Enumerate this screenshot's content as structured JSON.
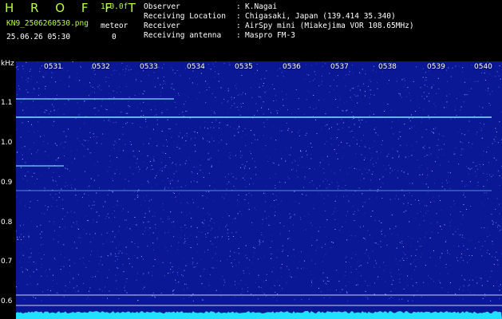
{
  "header": {
    "title": "H R O F F T",
    "version": "1.0.0f",
    "filename": "KN9_2506260530.png",
    "meteor_label": "meteor",
    "datetime": "25.06.26 05:30",
    "meteor_count": "0",
    "info": [
      {
        "label": "Observer",
        "value": "K.Nagai"
      },
      {
        "label": "Receiving Location",
        "value": "Chigasaki, Japan (139.414 35.340)"
      },
      {
        "label": "Receiver",
        "value": "AirSpy mini (Miakejima VOR 108.65MHz)"
      },
      {
        "label": "Receiving antenna",
        "value": "Maspro FM-3"
      }
    ],
    "colon": ":"
  },
  "waterfall": {
    "y_unit": "kHz",
    "y_ticks": [
      "1.1",
      "1.0",
      "0.9",
      "0.8",
      "0.7",
      "0.6"
    ],
    "x_ticks": [
      "0531",
      "0532",
      "0533",
      "0534",
      "0535",
      "0536",
      "0537",
      "0538",
      "0539",
      "0540"
    ],
    "colors": {
      "background": "#0b1896",
      "trace": "#7fd8ff",
      "noise_floor": "#22e0ff",
      "gridline": "#ffffff"
    }
  }
}
